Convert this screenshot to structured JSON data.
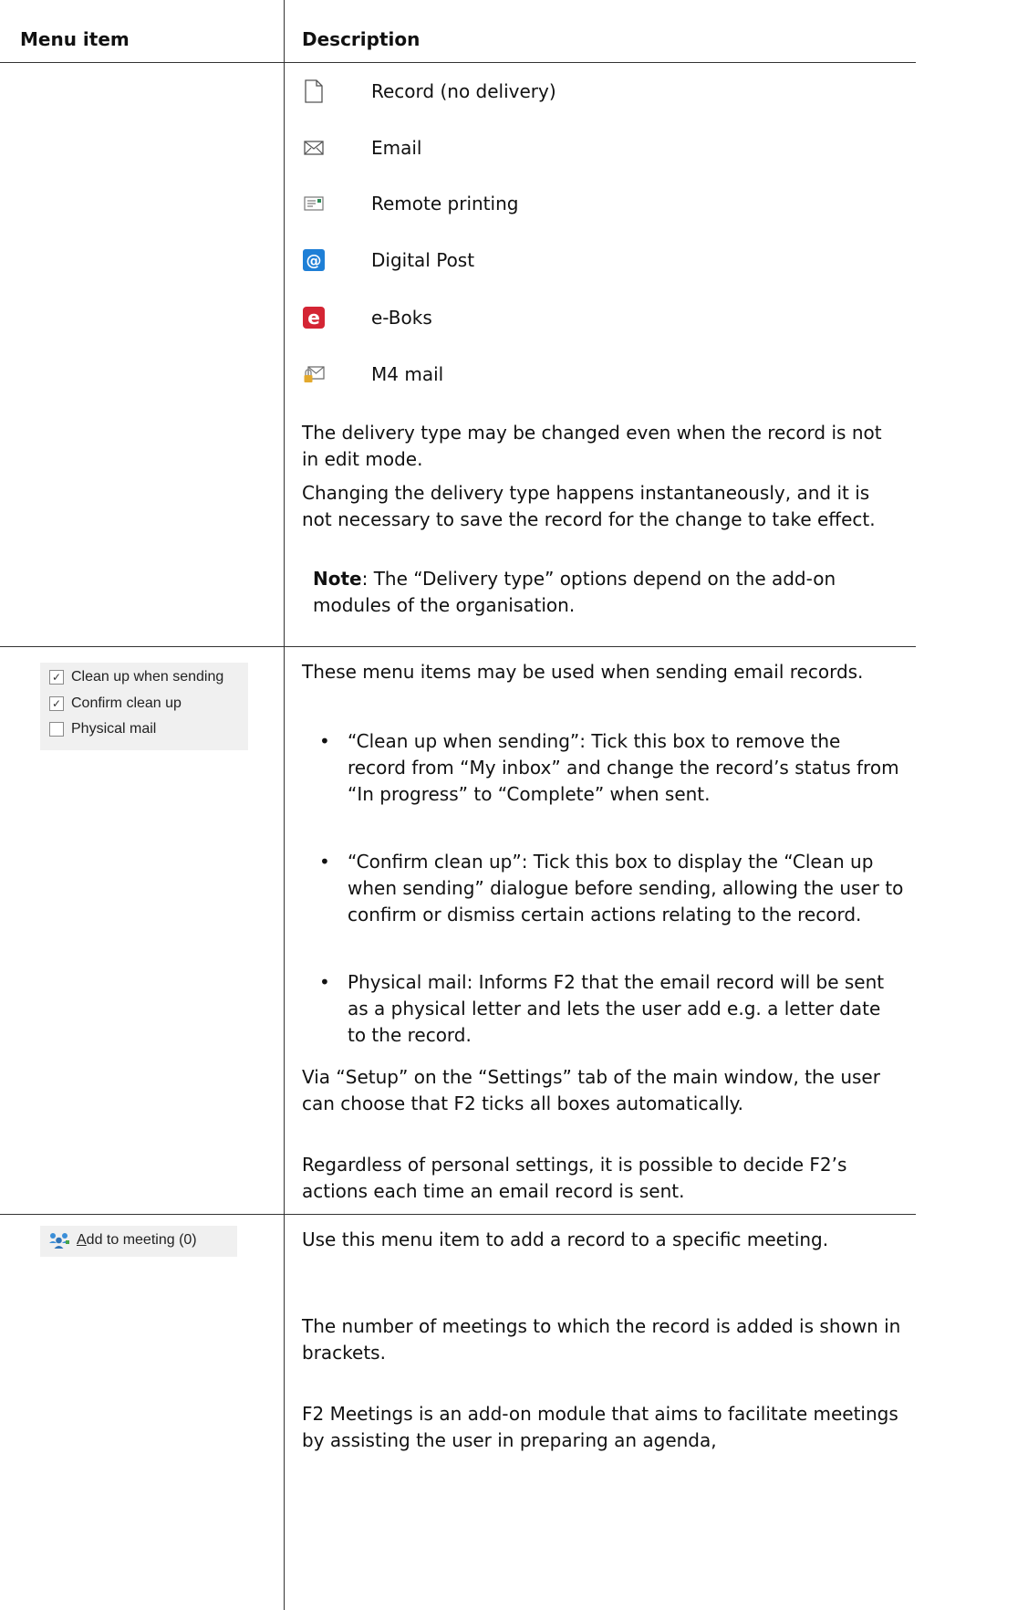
{
  "header": {
    "menu_item": "Menu item",
    "description": "Description"
  },
  "delivery_types": [
    {
      "icon": "blank-page-icon",
      "label": "Record (no delivery)"
    },
    {
      "icon": "envelope-icon",
      "label": "Email"
    },
    {
      "icon": "remote-printing-icon",
      "label": "Remote printing"
    },
    {
      "icon": "digital-post-at-icon",
      "label": "Digital Post"
    },
    {
      "icon": "eboks-icon",
      "label": "e-Boks"
    },
    {
      "icon": "m4-mail-lock-icon",
      "label": "M4 mail"
    }
  ],
  "delivery_section": {
    "para1": "The delivery type may be changed even when the record is not in edit mode.",
    "para2": "Changing the delivery type happens instantaneously, and it is not necessary to save the record for the change to take effect.",
    "note_label": "Note",
    "note_text": ": The “Delivery type” options depend on the add-on modules of the organisation."
  },
  "cleanup_ribbon": {
    "items": [
      {
        "label": "Clean up when sending",
        "checked": true
      },
      {
        "label": "Confirm clean up",
        "checked": true
      },
      {
        "label": "Physical mail",
        "checked": false
      }
    ]
  },
  "cleanup_section": {
    "intro": "These menu items may be used when sending email records.",
    "bullets": [
      "“Clean up when sending”: Tick this box to remove the record from “My inbox” and change the record’s status from “In progress” to “Complete” when sent.",
      "“Confirm clean up”: Tick this box to display the “Clean up when sending” dialogue before sending, allowing the user to confirm or dismiss certain actions relating to the record.",
      "Physical mail: Informs F2 that the email record will be sent as a physical letter and lets the user add e.g. a letter date to the record."
    ],
    "para1": "Via “Setup” on the “Settings” tab of the main window, the user can choose that F2 ticks all boxes automatically.",
    "para2": "Regardless of personal settings, it is possible to decide F2’s actions each time an email record is sent."
  },
  "meeting_ribbon": {
    "label_access": "A",
    "label_rest": "dd to meeting (0)"
  },
  "meeting_section": {
    "para1": "Use this menu item to add a record to a specific meeting.",
    "para2": "The number of meetings to which the record is added is shown in brackets.",
    "para3": "F2 Meetings is an add-on module that aims to facilitate meetings by assisting the user in preparing an agenda,"
  },
  "colors": {
    "digital_post_blue": "#1e7fd6",
    "eboks_red": "#d42534",
    "m4_lock_gold": "#e3a92d"
  }
}
